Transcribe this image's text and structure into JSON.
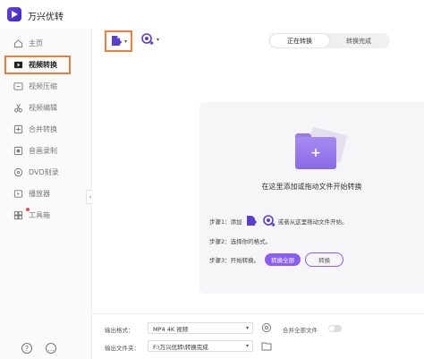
{
  "app": {
    "title": "万兴优转"
  },
  "sidebar": {
    "items": [
      {
        "label": "主页",
        "icon": "home-icon"
      },
      {
        "label": "视频转换",
        "icon": "video-convert-icon",
        "active": true
      },
      {
        "label": "视频压缩",
        "icon": "compress-icon"
      },
      {
        "label": "视频编辑",
        "icon": "scissors-icon"
      },
      {
        "label": "合并转换",
        "icon": "merge-icon"
      },
      {
        "label": "音画录制",
        "icon": "record-icon"
      },
      {
        "label": "DVD刻录",
        "icon": "disc-icon"
      },
      {
        "label": "播放器",
        "icon": "player-icon"
      },
      {
        "label": "工具箱",
        "icon": "toolbox-icon"
      }
    ],
    "footer_icons": [
      "help-icon",
      "feedback-icon"
    ]
  },
  "tabs": {
    "converting": "正在转换",
    "completed": "转换完成"
  },
  "dropzone": {
    "hint": "在这里添加或拖动文件开始转换",
    "step1_prefix": "步骤1：添加",
    "step1_suffix": "或者从这里拖动文件开始。",
    "step2": "步骤2：选择你的格式。",
    "step3": "步骤3：开始转换。",
    "convert_all_label": "转换全部",
    "convert_label": "转换"
  },
  "bottom": {
    "output_format_label": "输出格式：",
    "output_format_value": "MP4 4K 视频",
    "merge_all_label": "合并全部文件",
    "output_folder_label": "输出文件夹：",
    "output_folder_value": "F:\\万兴优转\\转换完成"
  },
  "colors": {
    "accent": "#8b5cf6",
    "highlight": "#ee7d3c"
  }
}
